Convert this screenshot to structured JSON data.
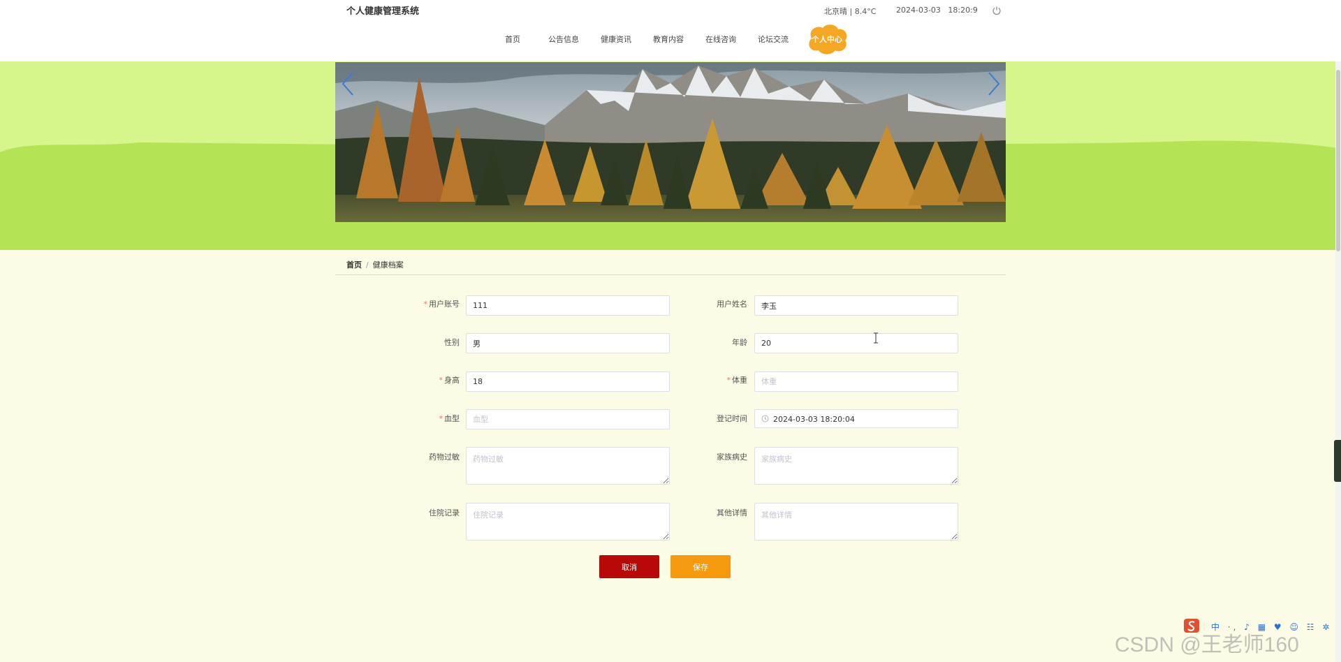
{
  "header": {
    "site_title": "个人健康管理系统",
    "weather": "北京晴 | 8.4°C",
    "datetime": "2024-03-03   18:20:9"
  },
  "nav": {
    "items": [
      "首页",
      "公告信息",
      "健康资讯",
      "教育内容",
      "在线咨询",
      "论坛交流"
    ],
    "active": "个人中心",
    "accent_color": "#f5a623"
  },
  "banner": {
    "bg_color": "#d6f58a",
    "stripe_color": "#b5e356"
  },
  "breadcrumb": {
    "home": "首页",
    "separator": "/",
    "current": "健康档案"
  },
  "form": {
    "account": {
      "label": "用户账号",
      "value": "111",
      "required": true
    },
    "name": {
      "label": "用户姓名",
      "value": "李玉"
    },
    "gender": {
      "label": "性别",
      "value": "男"
    },
    "age": {
      "label": "年龄",
      "value": "20"
    },
    "height": {
      "label": "身高",
      "value": "18",
      "required": true
    },
    "weight": {
      "label": "体重",
      "placeholder": "体重",
      "required": true
    },
    "blood_type": {
      "label": "血型",
      "placeholder": "血型",
      "required": true
    },
    "register_time": {
      "label": "登记时间",
      "value": "2024-03-03 18:20:04"
    },
    "drug_allergy": {
      "label": "药物过敏",
      "placeholder": "药物过敏"
    },
    "family_history": {
      "label": "家族病史",
      "placeholder": "家族病史"
    },
    "hospital_record": {
      "label": "住院记录",
      "placeholder": "住院记录"
    },
    "other_details": {
      "label": "其他详情",
      "placeholder": "其他详情"
    }
  },
  "buttons": {
    "cancel": "取消",
    "save": "保存",
    "cancel_color": "#b80808",
    "save_color": "#f59a0d"
  },
  "ime": {
    "items": "中 ·, ♪ ▦ ♥ ☺ ☷ ✲"
  },
  "watermark": "CSDN @王老师160"
}
